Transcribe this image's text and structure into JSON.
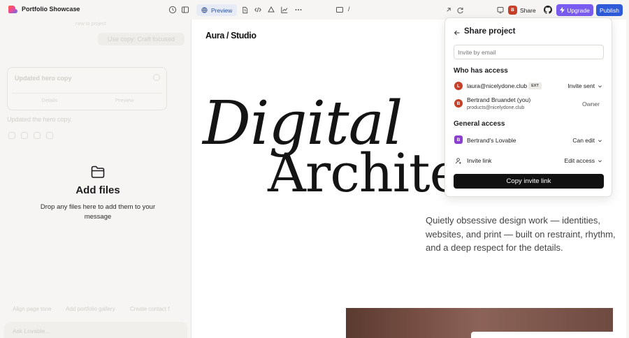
{
  "colors": {
    "brand_accent": "#2f5ad8",
    "upgrade_purple": "#7b5cf0",
    "avatar_red": "#c63f28",
    "avatar_purple": "#8a3fd1",
    "preview_bg": "#e6ebf5"
  },
  "topbar": {
    "project_title": "Portfolio Showcase",
    "preview_label": "Preview",
    "url_path": "/",
    "share_label": "Share",
    "share_avatar": "B",
    "upgrade_label": "Upgrade",
    "publish_label": "Publish",
    "icons": [
      "brand-logo-icon",
      "history-icon",
      "sidebar-toggle-icon",
      "globe-icon",
      "file-icon",
      "code-icon",
      "cloud-icon",
      "chart-icon",
      "more-icon",
      "monitor-icon",
      "external-link-icon",
      "refresh-icon",
      "device-icon",
      "github-icon",
      "bolt-icon"
    ]
  },
  "chat": {
    "faded_meta": "new to project",
    "faded_bubble": "Use copy: Craft focused",
    "card_title": "Updated hero copy",
    "card_tabs": [
      "Details",
      "Preview"
    ],
    "updated_note": "Updated the hero copy.",
    "drop_title": "Add files",
    "drop_subtitle": "Drop any files here to add them to your message",
    "suggestions": [
      "Align page tone",
      "Add portfolio gallery",
      "Create contact f"
    ],
    "composer_placeholder": "Ask Lovable..."
  },
  "preview": {
    "site_logo": "Aura / Studio",
    "hero_line1": "Digital",
    "hero_line2": "Architec",
    "hero_description": "Quietly obsessive design work — identities, websites, and print — built on restraint, rhythm, and a deep respect for the details."
  },
  "share_modal": {
    "title": "Share project",
    "invite_placeholder": "Invite by email",
    "who_has_access": "Who has access",
    "members": [
      {
        "avatar": "L",
        "email": "laura@nicelydone.club",
        "badge": "EXT",
        "role": "Invite sent"
      },
      {
        "avatar": "B",
        "name": "Bertrand Bruandet (you)",
        "email": "products@nicelydone.club",
        "role": "Owner"
      }
    ],
    "general_access": "General access",
    "workspace": {
      "avatar": "B",
      "name": "Bertrand's Lovable",
      "role": "Can edit"
    },
    "invite_link": {
      "label": "Invite link",
      "role": "Edit access"
    },
    "copy_button": "Copy invite link"
  }
}
